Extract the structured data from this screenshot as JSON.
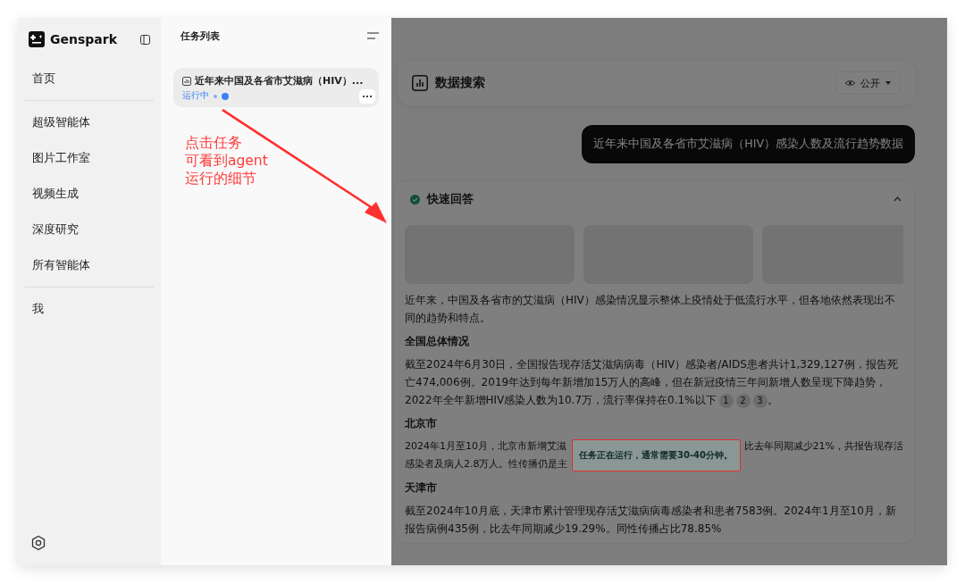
{
  "sidebar": {
    "brand": "Genspark",
    "nav_groups": [
      [
        "首页"
      ],
      [
        "超级智能体",
        "图片工作室",
        "视频生成",
        "深度研究",
        "所有智能体"
      ],
      [
        "我"
      ]
    ]
  },
  "tasks": {
    "title": "任务列表",
    "items": [
      {
        "title": "近年来中国及各省市艾滋病（HIV）...",
        "status": "运行中"
      }
    ]
  },
  "annotation": {
    "lines": [
      "点击任务",
      "可看到agent",
      "运行的细节"
    ]
  },
  "main": {
    "header": {
      "title": "数据搜索",
      "visibility": "公开"
    },
    "user_message": "近年来中国及各省市艾滋病（HIV）感染人数及流行趋势数据",
    "quick_answer": {
      "title": "快速回答",
      "expanded": true,
      "blocks": [
        {
          "kind": "paragraph",
          "text": "近年来，中国及各省市的艾滋病（HIV）感染情况显示整体上疫情处于低流行水平，但各地依然表现出不同的趋势和特点。"
        },
        {
          "kind": "heading",
          "text": "全国总体情况"
        },
        {
          "kind": "paragraph",
          "text": "截至2024年6月30日，全国报告现存活艾滋病病毒（HIV）感染者/AIDS患者共计1,329,127例，报告死亡474,006例。2019年达到每年新增加15万人的高峰，但在新冠疫情三年间新增人数呈现下降趋势，2022年全年新增HIV感染人数为10.7万，流行率保持在0.1%以下",
          "citations": [
            "1",
            "2",
            "3"
          ],
          "tail": "。"
        },
        {
          "kind": "heading",
          "text": "北京市"
        },
        {
          "kind": "covered",
          "lines": [
            [
              "2024年1月至10月，北京市新增艾滋",
              "比去年同期减少21%，共报告现存活"
            ],
            [
              "感染者及病人2.8万人。性传播仍是主"
            ]
          ]
        },
        {
          "kind": "heading",
          "text": "天津市"
        },
        {
          "kind": "paragraph",
          "text": "截至2024年10月底，天津市累计管理现存活艾滋病病毒感染者和患者7583例。2024年1月至10月，新报告病例435例，比去年同期减少19.29%。同性传播占比78.85%"
        }
      ]
    },
    "toast": "任务正在运行，通常需要30-40分钟。"
  }
}
